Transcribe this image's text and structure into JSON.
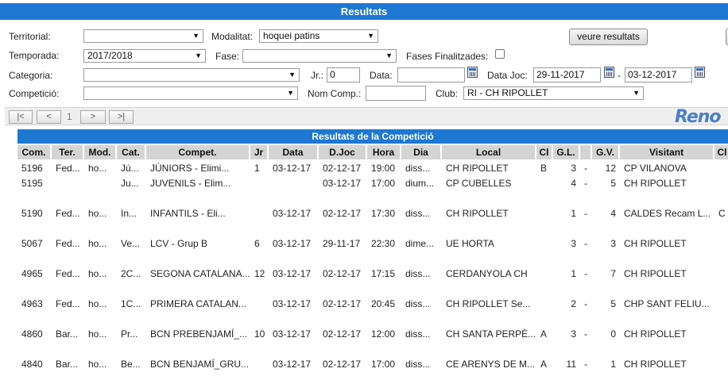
{
  "title": "Resultats",
  "filters": {
    "territorial_label": "Territorial:",
    "territorial_value": "",
    "modalitat_label": "Modalitat:",
    "modalitat_value": "hoquei patins",
    "temporada_label": "Temporada:",
    "temporada_value": "2017/2018",
    "fase_label": "Fase:",
    "fase_value": "",
    "fases_finalitzades_label": "Fases Finalitzades:",
    "categoria_label": "Categoria:",
    "categoria_value": "",
    "jr_label": "Jr.:",
    "jr_value": "0",
    "data_label": "Data:",
    "data_value": "",
    "data_joc_label": "Data Joc:",
    "data_joc_from": "29-11-2017",
    "data_joc_sep": "-",
    "data_joc_to": "03-12-2017",
    "competicio_label": "Competició:",
    "competicio_value": "",
    "nom_comp_label": "Nom Comp.:",
    "nom_comp_value": "",
    "club_label": "Club:",
    "club_value": "RI - CH RIPOLLET",
    "submit_label": "veure resultats"
  },
  "pager": {
    "first": "|<",
    "prev": "<",
    "page": "1",
    "next": ">",
    "last": ">|"
  },
  "logo_text": "Reno",
  "table": {
    "caption": "Resultats de la Competició",
    "headers": [
      "Com.",
      "Ter.",
      "Mod.",
      "Cat.",
      "Compet.",
      "Jr",
      "Data",
      "D.Joc",
      "Hora",
      "Dia",
      "Local",
      "Cl",
      "G.L.",
      "",
      "G.V.",
      "Visitant",
      "Cl"
    ],
    "rows": [
      [
        "5196",
        "Fed...",
        "ho...",
        "Jú...",
        "JÚNIORS - Elimi...",
        "1",
        "03-12-17",
        "02-12-17",
        "19:00",
        "diss...",
        "CH RIPOLLET",
        "B",
        "3",
        "-",
        "12",
        "CP VILANOVA",
        ""
      ],
      [
        "5195",
        "",
        "",
        "Ju...",
        "JUVENILS - Elim...",
        "",
        "",
        "03-12-17",
        "17:00",
        "dium...",
        "CP CUBELLES",
        "",
        "4",
        "-",
        "5",
        "CH RIPOLLET",
        ""
      ],
      [
        "5190",
        "Fed...",
        "ho...",
        "In...",
        "INFANTILS - Eli...",
        "",
        "03-12-17",
        "02-12-17",
        "17:30",
        "diss...",
        "CH RIPOLLET",
        "",
        "1",
        "-",
        "4",
        "CALDES Recam L...",
        "C"
      ],
      [
        "5067",
        "Fed...",
        "ho...",
        "Ve...",
        "LCV - Grup B",
        "6",
        "03-12-17",
        "29-11-17",
        "22:30",
        "dime...",
        "UE HORTA",
        "",
        "3",
        "-",
        "3",
        "CH RIPOLLET",
        ""
      ],
      [
        "4965",
        "Fed...",
        "ho...",
        "2C...",
        "SEGONA CATALANA...",
        "12",
        "03-12-17",
        "02-12-17",
        "17:15",
        "diss...",
        "CERDANYOLA CH",
        "",
        "1",
        "-",
        "7",
        "CH RIPOLLET",
        ""
      ],
      [
        "4963",
        "Fed...",
        "ho...",
        "1C...",
        "PRIMERA CATALAN...",
        "",
        "03-12-17",
        "02-12-17",
        "20:45",
        "diss...",
        "CH RIPOLLET Se...",
        "",
        "2",
        "-",
        "5",
        "CHP SANT FELIU...",
        ""
      ],
      [
        "4860",
        "Bar...",
        "ho...",
        "Pr...",
        "BCN PREBENJAMÍ_...",
        "10",
        "03-12-17",
        "02-12-17",
        "12:00",
        "diss...",
        "CH SANTA PERPÈ...",
        "A",
        "3",
        "-",
        "0",
        "CH RIPOLLET",
        ""
      ],
      [
        "4840",
        "Bar...",
        "ho...",
        "Be...",
        "BCN BENJAMÍ_GRU...",
        "",
        "03-12-17",
        "02-12-17",
        "17:00",
        "diss...",
        "CE ARENYS DE M...",
        "A",
        "11",
        "-",
        "1",
        "CH RIPOLLET",
        ""
      ]
    ]
  }
}
